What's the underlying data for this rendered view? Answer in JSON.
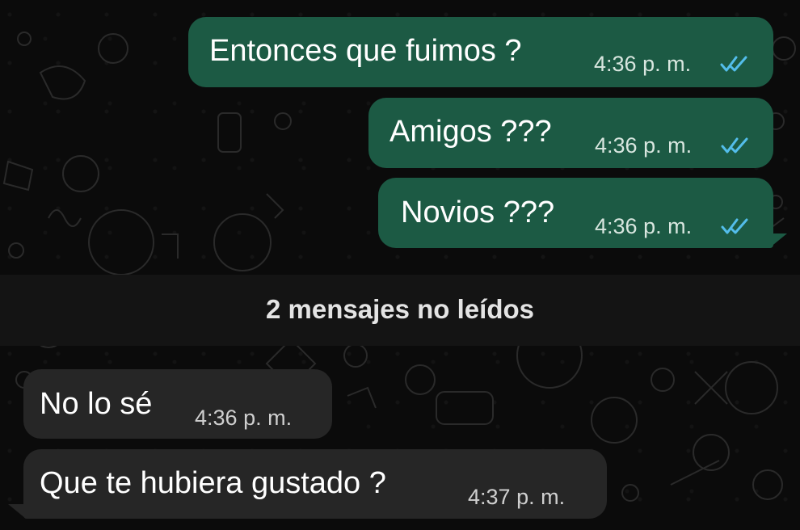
{
  "outgoing": [
    {
      "text": "Entonces que fuimos ?",
      "time": "4:36",
      "ampm": "p. m.",
      "status": "read-double-check"
    },
    {
      "text": "Amigos ???",
      "time": "4:36",
      "ampm": "p. m.",
      "status": "read-double-check"
    },
    {
      "text": "Novios ???",
      "time": "4:36",
      "ampm": "p. m.",
      "status": "read-double-check"
    }
  ],
  "unread_divider": "2 mensajes no leídos",
  "incoming": [
    {
      "text": "No lo sé",
      "time": "4:36",
      "ampm": "p. m."
    },
    {
      "text": "Que te hubiera gustado ?",
      "time": "4:37",
      "ampm": "p. m."
    }
  ],
  "colors": {
    "outgoing_bubble": "#1c5a44",
    "incoming_bubble": "#262626",
    "read_ticks": "#53bdeb",
    "background": "#0b0b0b"
  },
  "icons": [
    "double-check-icon"
  ]
}
